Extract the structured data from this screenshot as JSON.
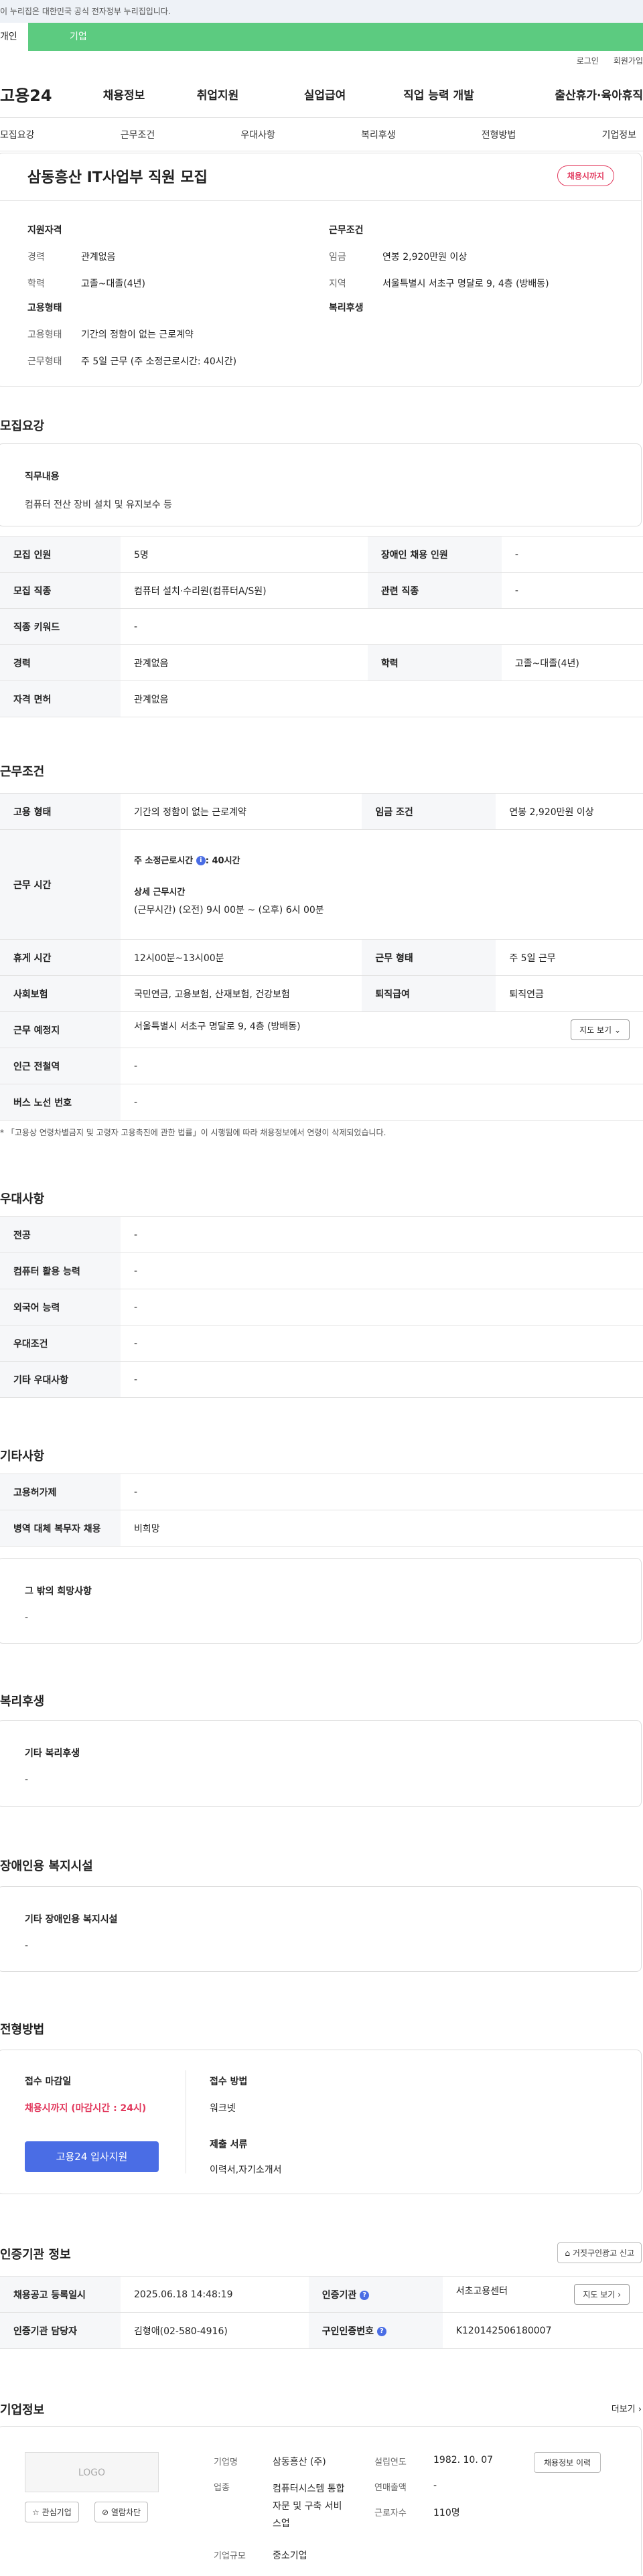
{
  "gov_banner": "이 누리집은 대한민국 공식 전자정부 누리집입니다.",
  "user_tabs": [
    "개인",
    "기업"
  ],
  "utils": [
    "로그인",
    "회원가입"
  ],
  "logo": "고용24",
  "gnb": [
    "채용정보",
    "취업지원",
    "실업급여",
    "직업 능력 개발",
    "출산휴가·육아휴직"
  ],
  "anchors": [
    "모집요강",
    "근무조건",
    "우대사항",
    "복리후생",
    "전형방법",
    "기업정보"
  ],
  "summary": {
    "title": "삼동흥산 IT사업부 직원 모집",
    "badge": "채용시까지",
    "qual_h": "지원자격",
    "career_k": "경력",
    "career_v": "관계없음",
    "edu_k": "학력",
    "edu_v": "고졸~대졸(4년)",
    "emp_h": "고용형태",
    "emp_k1": "고용형태",
    "emp_v1": "기간의 정함이 없는 근로계약",
    "emp_k2": "근무형태",
    "emp_v2": "주 5일 근무 (주 소정근로시간: 40시간)",
    "cond_h": "근무조건",
    "wage_k": "임금",
    "wage_v": "연봉 2,920만원 이상",
    "region_k": "지역",
    "region_v": "서울특별시 서초구 명달로 9, 4층 (방배동)",
    "welfare_h": "복리후생"
  },
  "recruit": {
    "h": "모집요강",
    "duty_h": "직무내용",
    "duty_v": "컴퓨터 전산 장비 설치 및 유지보수 등",
    "rows": [
      [
        "모집 인원",
        "5명",
        "장애인 채용 인원",
        "-"
      ],
      [
        "모집 직종",
        "컴퓨터 설치·수리원(컴퓨터A/S원)",
        "관련 직종",
        "-"
      ],
      [
        "직종 키워드",
        "-"
      ],
      [
        "경력",
        "관계없음",
        "학력",
        "고졸~대졸(4년)"
      ],
      [
        "자격 면허",
        "관계없음"
      ]
    ]
  },
  "cond": {
    "h": "근무조건",
    "emp_k": "고용 형태",
    "emp_v": "기간의 정함이 없는 근로계약",
    "wage_k": "임금 조건",
    "wage_v": "연봉 2,920만원 이상",
    "time_k": "근무 시간",
    "time_v1": "주 소정근로시간",
    "time_v1b": ": 40시간",
    "time_v2": "상세 근무시간",
    "time_v3": "(근무시간) (오전) 9시 00분 ~ (오후) 6시 00분",
    "rest_k": "휴게 시간",
    "rest_v": "12시00분~13시00분",
    "form_k": "근무 형태",
    "form_v": "주 5일 근무",
    "ins_k": "사회보험",
    "ins_v": "국민연금, 고용보험, 산재보험, 건강보험",
    "ret_k": "퇴직급여",
    "ret_v": "퇴직연금",
    "place_k": "근무 예정지",
    "place_v": "서울특별시 서초구 명달로 9, 4층 (방배동)",
    "map_btn": "지도 보기",
    "sub_k": "인근 전철역",
    "sub_v": "-",
    "bus_k": "버스 노선 번호",
    "bus_v": "-",
    "note": "* 「고용상 연령차별금지 및 고령자 고용촉진에 관한 법률」이 시행됨에 따라 채용정보에서 연령이 삭제되었습니다."
  },
  "pref": {
    "h": "우대사항",
    "rows": [
      [
        "전공",
        "-"
      ],
      [
        "컴퓨터 활용 능력",
        "-"
      ],
      [
        "외국어 능력",
        "-"
      ],
      [
        "우대조건",
        "-"
      ],
      [
        "기타 우대사항",
        "-"
      ]
    ]
  },
  "etc": {
    "h": "기타사항",
    "rows": [
      [
        "고용허가제",
        "-"
      ],
      [
        "병역 대체 복무자 채용",
        "비희망"
      ]
    ],
    "box_h": "그 밖의 희망사항",
    "box_v": "-"
  },
  "welfare": {
    "h": "복리후생",
    "box_h": "기타 복리후생",
    "box_v": "-"
  },
  "disab": {
    "h": "장애인용 복지시설",
    "box_h": "기타 장애인용 복지시설",
    "box_v": "-"
  },
  "screen": {
    "h": "전형방법",
    "deadline_h": "접수 마감일",
    "deadline_v": "채용시까지 (마감시간 : 24시)",
    "apply": "고용24 입사지원",
    "method_h": "접수 방법",
    "method_v": "워크넷",
    "docs_h": "제출 서류",
    "docs_v": "이력서,자기소개서"
  },
  "agency": {
    "h": "인증기관 정보",
    "report": "거짓구인광고 신고",
    "reg_k": "채용공고 등록일시",
    "reg_v": "2025.06.18 14:48:19",
    "org_k": "인증기관",
    "org_v": "서초고용센터",
    "map_btn": "지도 보기",
    "mgr_k": "인증기관 담당자",
    "mgr_v": "김형애(02-580-4916)",
    "no_k": "구인인증번호",
    "no_v": "K120142506180007"
  },
  "company": {
    "h": "기업정보",
    "more": "더보기",
    "logo": "LOGO",
    "fav": "관심기업",
    "block": "열람차단",
    "name_k": "기업명",
    "name_v": "삼동흥산 (주)",
    "ind_k": "업종",
    "ind_v": "컴퓨터시스템 통합 자문 및 구축 서비스업",
    "size_k": "기업규모",
    "size_v": "중소기업",
    "est_k": "설립연도",
    "est_v": "1982. 10. 07",
    "sales_k": "연매출액",
    "sales_v": "-",
    "emp_k": "근로자수",
    "emp_v": "110명",
    "jobs_btn": "채용정보 이력"
  }
}
